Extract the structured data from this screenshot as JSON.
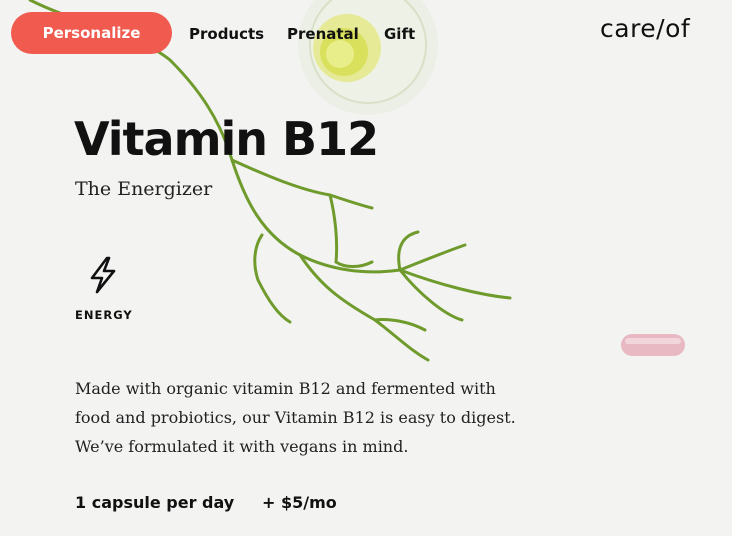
{
  "nav": {
    "personalize_label": "Personalize",
    "links": [
      "Products",
      "Prenatal",
      "Gift"
    ],
    "logo": "care/of"
  },
  "product": {
    "title": "Vitamin B12",
    "subtitle": "The Energizer",
    "benefit": {
      "icon": "lightning-bolt-icon",
      "label": "ENERGY"
    },
    "description_lines": [
      "Made with organic vitamin B12 and fermented with",
      "food and probiotics, our Vitamin B12 is easy to digest.",
      "We’ve formulated it with vegans in mind."
    ],
    "dosage": "1 capsule per day",
    "price": "+ $5/mo"
  },
  "colors": {
    "accent": "#f05a4f",
    "background": "#f3f3f2",
    "text": "#111111",
    "plant": "#6f9a2c",
    "capsule": "#e8b9c3"
  }
}
